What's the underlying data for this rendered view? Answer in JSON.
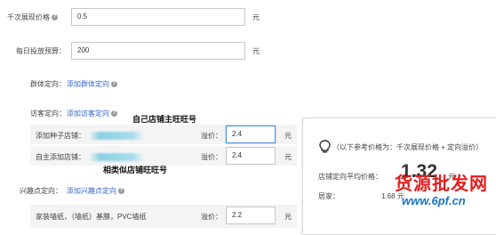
{
  "form": {
    "cpm_label": "千次展现价格",
    "cpm_value": "0.5",
    "cpm_unit": "元",
    "budget_label": "每日投放预算：",
    "budget_value": "200",
    "budget_unit": "元",
    "crowd_label": "群体定向：",
    "crowd_link": "添加群体定向",
    "visitor_label": "访客定向：",
    "visitor_link": "添加访客定向",
    "seed_label": "添加种子店铺：",
    "seed_bid_label": "溢价：",
    "seed_bid_value": "2.4",
    "seed_unit": "元",
    "auto_label": "自主添加店铺：",
    "auto_bid_label": "溢价：",
    "auto_bid_value": "2.4",
    "auto_unit": "元",
    "interest_label": "兴趣点定向：",
    "interest_link": "添加兴趣点定向",
    "interest_item": "家装墙纸，（墙纸）基膜，PVC墙纸",
    "interest_bid_label": "溢价：",
    "interest_bid_value": "2.2",
    "interest_unit": "元"
  },
  "annotations": {
    "own_shop": "自己店铺主旺旺号",
    "similar_shop": "相类似店铺旺旺号"
  },
  "reference_panel": {
    "hint": "（以下参考价格为：千次展现价格 + 定向溢价）",
    "avg_label": "店铺定向平均价格：",
    "avg_value": "1.32",
    "avg_unit": "元",
    "home_label": "居家：",
    "home_value": "1.68",
    "home_unit": "元"
  },
  "watermark": {
    "title": "货源批发网",
    "url": "www.6pf.cn"
  },
  "colors": {
    "link": "#3366cc",
    "watermark_red": "#e02020",
    "watermark_blue": "#1a73c8",
    "focus_border": "#4a90d9"
  },
  "icons": {
    "help": "question-circle-icon",
    "lightbulb": "lightbulb-icon"
  }
}
